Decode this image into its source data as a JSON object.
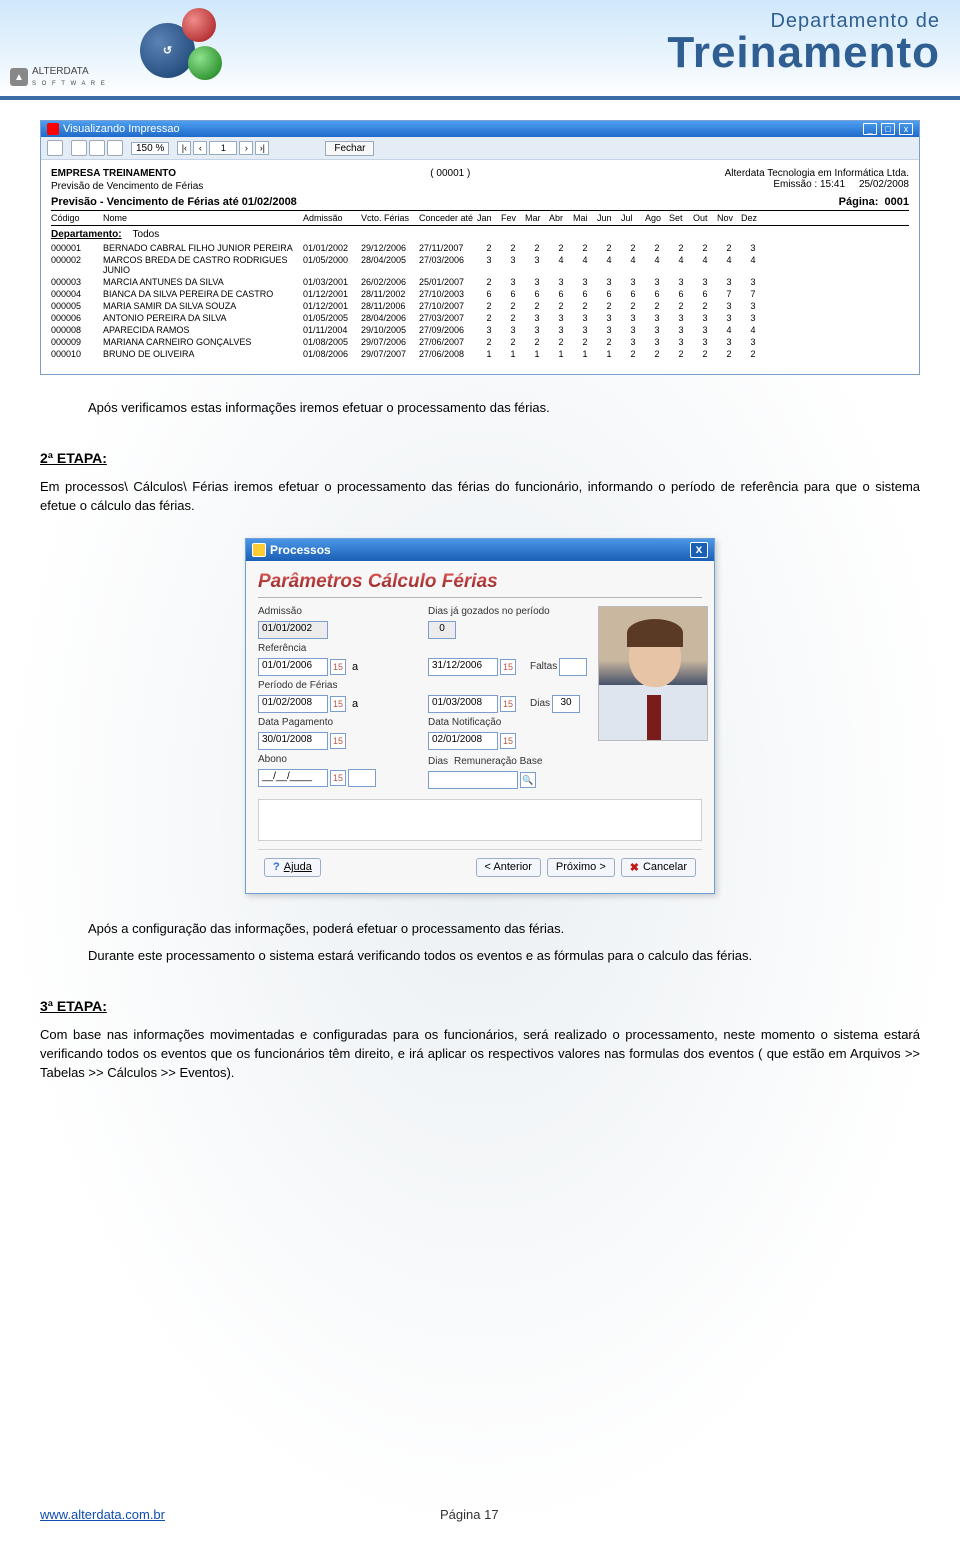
{
  "banner": {
    "company_small": "ALTERDATA",
    "company_small_sub": "S O F T W A R E",
    "suptitle": "Departamento de",
    "maintitle": "Treinamento"
  },
  "report": {
    "window_title": "Visualizando Impressao",
    "zoom": "150 %",
    "page_current": "1",
    "close_label": "Fechar",
    "company": "EMPRESA TREINAMENTO",
    "company_code": "( 00001 )",
    "vendor": "Alterdata Tecnologia em Informática Ltda.",
    "subtitle": "Previsão de Vencimento de  Férias",
    "emission_label": "Emissão :",
    "emission_time": "15:41",
    "emission_date": "25/02/2008",
    "section_title": "Previsão - Vencimento de Férias até 01/02/2008",
    "page_label": "Página:",
    "page_no": "0001",
    "col_codigo": "Código",
    "col_nome": "Nome",
    "col_admissao": "Admissão",
    "col_vcto": "Vcto. Férias",
    "col_conceder": "Conceder até",
    "months": [
      "Jan",
      "Fev",
      "Mar",
      "Abr",
      "Mai",
      "Jun",
      "Jul",
      "Ago",
      "Set",
      "Out",
      "Nov",
      "Dez"
    ],
    "depto_label": "Departamento:",
    "depto_value": "Todos",
    "rows": [
      {
        "cod": "000001",
        "nome": "BERNADO CABRAL FILHO JUNIOR PEREIRA",
        "adm": "01/01/2002",
        "vcto": "29/12/2006",
        "conc": "27/11/2007",
        "m": [
          "2",
          "2",
          "2",
          "2",
          "2",
          "2",
          "2",
          "2",
          "2",
          "2",
          "2",
          "3"
        ]
      },
      {
        "cod": "000002",
        "nome": "MARCOS BREDA DE CASTRO RODRIGUES JUNIO",
        "adm": "01/05/2000",
        "vcto": "28/04/2005",
        "conc": "27/03/2006",
        "m": [
          "3",
          "3",
          "3",
          "4",
          "4",
          "4",
          "4",
          "4",
          "4",
          "4",
          "4",
          "4"
        ]
      },
      {
        "cod": "000003",
        "nome": "MARCIA ANTUNES DA SILVA",
        "adm": "01/03/2001",
        "vcto": "26/02/2006",
        "conc": "25/01/2007",
        "m": [
          "2",
          "3",
          "3",
          "3",
          "3",
          "3",
          "3",
          "3",
          "3",
          "3",
          "3",
          "3"
        ]
      },
      {
        "cod": "000004",
        "nome": "BIANCA DA SILVA PEREIRA DE CASTRO",
        "adm": "01/12/2001",
        "vcto": "28/11/2002",
        "conc": "27/10/2003",
        "m": [
          "6",
          "6",
          "6",
          "6",
          "6",
          "6",
          "6",
          "6",
          "6",
          "6",
          "7",
          "7"
        ]
      },
      {
        "cod": "000005",
        "nome": "MARIA SAMIR DA SILVA SOUZA",
        "adm": "01/12/2001",
        "vcto": "28/11/2006",
        "conc": "27/10/2007",
        "m": [
          "2",
          "2",
          "2",
          "2",
          "2",
          "2",
          "2",
          "2",
          "2",
          "2",
          "3",
          "3"
        ]
      },
      {
        "cod": "000006",
        "nome": "ANTONIO PEREIRA DA SILVA",
        "adm": "01/05/2005",
        "vcto": "28/04/2006",
        "conc": "27/03/2007",
        "m": [
          "2",
          "2",
          "3",
          "3",
          "3",
          "3",
          "3",
          "3",
          "3",
          "3",
          "3",
          "3"
        ]
      },
      {
        "cod": "000008",
        "nome": "APARECIDA RAMOS",
        "adm": "01/11/2004",
        "vcto": "29/10/2005",
        "conc": "27/09/2006",
        "m": [
          "3",
          "3",
          "3",
          "3",
          "3",
          "3",
          "3",
          "3",
          "3",
          "3",
          "4",
          "4"
        ]
      },
      {
        "cod": "000009",
        "nome": "MARIANA CARNEIRO GONÇALVES",
        "adm": "01/08/2005",
        "vcto": "29/07/2006",
        "conc": "27/06/2007",
        "m": [
          "2",
          "2",
          "2",
          "2",
          "2",
          "2",
          "3",
          "3",
          "3",
          "3",
          "3",
          "3"
        ]
      },
      {
        "cod": "000010",
        "nome": "BRUNO DE OLIVEIRA",
        "adm": "01/08/2006",
        "vcto": "29/07/2007",
        "conc": "27/06/2008",
        "m": [
          "1",
          "1",
          "1",
          "1",
          "1",
          "1",
          "2",
          "2",
          "2",
          "2",
          "2",
          "2"
        ]
      }
    ]
  },
  "text": {
    "after_report": "Após verificamos estas informações iremos efetuar o processamento das férias.",
    "stage2_label": "2ª ETAPA:",
    "stage2_body": "Em processos\\ Cálculos\\ Férias iremos efetuar o processamento das férias do funcionário, informando o período de referência para que o sistema efetue o cálculo das férias.",
    "after_dialog_1": "Após a configuração das informações, poderá efetuar o processamento das férias.",
    "after_dialog_2": "Durante este processamento o sistema estará verificando todos os eventos e as fórmulas para o calculo das férias.",
    "stage3_label": "3ª ETAPA:",
    "stage3_body": "Com base nas informações movimentadas e configuradas para os funcionários, será realizado o processamento, neste momento o sistema estará verificando todos os eventos que os funcionários têm direito, e irá aplicar os respectivos valores nas formulas dos eventos ( que estão em Arquivos >> Tabelas >> Cálculos >> Eventos)."
  },
  "dialog": {
    "title": "Processos",
    "heading": "Parâmetros Cálculo Férias",
    "labels": {
      "admissao": "Admissão",
      "dias_gozados": "Dias já gozados no período",
      "referencia": "Referência",
      "faltas": "Faltas",
      "periodo": "Período de Férias",
      "dias": "Dias",
      "data_pag": "Data Pagamento",
      "data_notif": "Data Notificação",
      "abono": "Abono",
      "dias2": "Dias",
      "remun": "Remuneração Base",
      "a": "a"
    },
    "values": {
      "admissao": "01/01/2002",
      "dias_gozados": "0",
      "ref_ini": "01/01/2006",
      "ref_fim": "31/12/2006",
      "faltas": "",
      "per_ini": "01/02/2008",
      "per_fim": "01/03/2008",
      "dias": "30",
      "data_pag": "30/01/2008",
      "data_notif": "02/01/2008",
      "abono": "__/__/____",
      "dias2": "",
      "remun": ""
    },
    "buttons": {
      "ajuda": "Ajuda",
      "anterior": "< Anterior",
      "proximo": "Próximo >",
      "cancelar": "Cancelar"
    }
  },
  "footer": {
    "url": "www.alterdata.com.br",
    "page": "Página 17"
  }
}
